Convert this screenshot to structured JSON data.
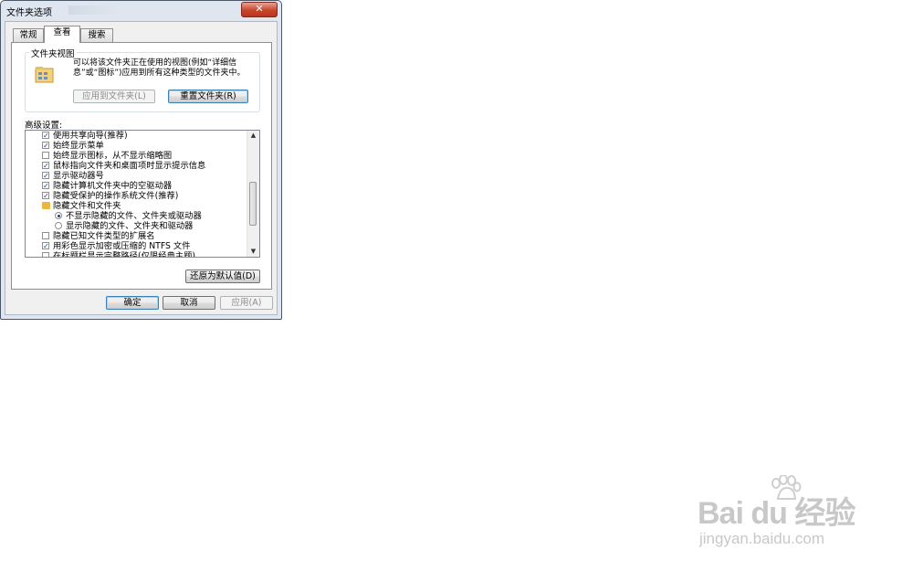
{
  "window": {
    "title": "文件夹选项",
    "close_glyph": "✕"
  },
  "tabs": [
    {
      "label": "常规",
      "active": false
    },
    {
      "label": "查看",
      "active": true
    },
    {
      "label": "搜索",
      "active": false
    }
  ],
  "folder_view": {
    "group_title": "文件夹视图",
    "description": "可以将该文件夹正在使用的视图(例如“详细信息”或“图标”)应用到所有这种类型的文件夹中。",
    "apply_button": "应用到文件夹(L)",
    "reset_button": "重置文件夹(R)"
  },
  "advanced": {
    "label": "高级设置:",
    "items": [
      {
        "type": "checkbox",
        "checked": true,
        "label": "使用共享向导(推荐)",
        "indent": 1
      },
      {
        "type": "checkbox",
        "checked": true,
        "label": "始终显示菜单",
        "indent": 1
      },
      {
        "type": "checkbox",
        "checked": false,
        "label": "始终显示图标，从不显示缩略图",
        "indent": 1
      },
      {
        "type": "checkbox",
        "checked": true,
        "label": "鼠标指向文件夹和桌面项时显示提示信息",
        "indent": 1
      },
      {
        "type": "checkbox",
        "checked": true,
        "label": "显示驱动器号",
        "indent": 1
      },
      {
        "type": "checkbox",
        "checked": true,
        "label": "隐藏计算机文件夹中的空驱动器",
        "indent": 1
      },
      {
        "type": "checkbox",
        "checked": true,
        "label": "隐藏受保护的操作系统文件(推荐)",
        "indent": 1
      },
      {
        "type": "folder",
        "checked": false,
        "label": "隐藏文件和文件夹",
        "indent": 1
      },
      {
        "type": "radio",
        "checked": true,
        "label": "不显示隐藏的文件、文件夹或驱动器",
        "indent": 2
      },
      {
        "type": "radio",
        "checked": false,
        "label": "显示隐藏的文件、文件夹和驱动器",
        "indent": 2
      },
      {
        "type": "checkbox",
        "checked": false,
        "label": "隐藏已知文件类型的扩展名",
        "indent": 1
      },
      {
        "type": "checkbox",
        "checked": true,
        "label": "用彩色显示加密或压缩的 NTFS 文件",
        "indent": 1
      },
      {
        "type": "checkbox",
        "checked": false,
        "label": "在标题栏显示完整路径(仅限经典主题)",
        "indent": 1,
        "cut": true
      }
    ],
    "scroll_up": "▲",
    "scroll_down": "▼",
    "restore_defaults": "还原为默认值(D)"
  },
  "footer": {
    "ok": "确定",
    "cancel": "取消",
    "apply": "应用(A)"
  },
  "watermark": {
    "logo": "Bai du 经验",
    "url": "jingyan.baidu.com"
  }
}
